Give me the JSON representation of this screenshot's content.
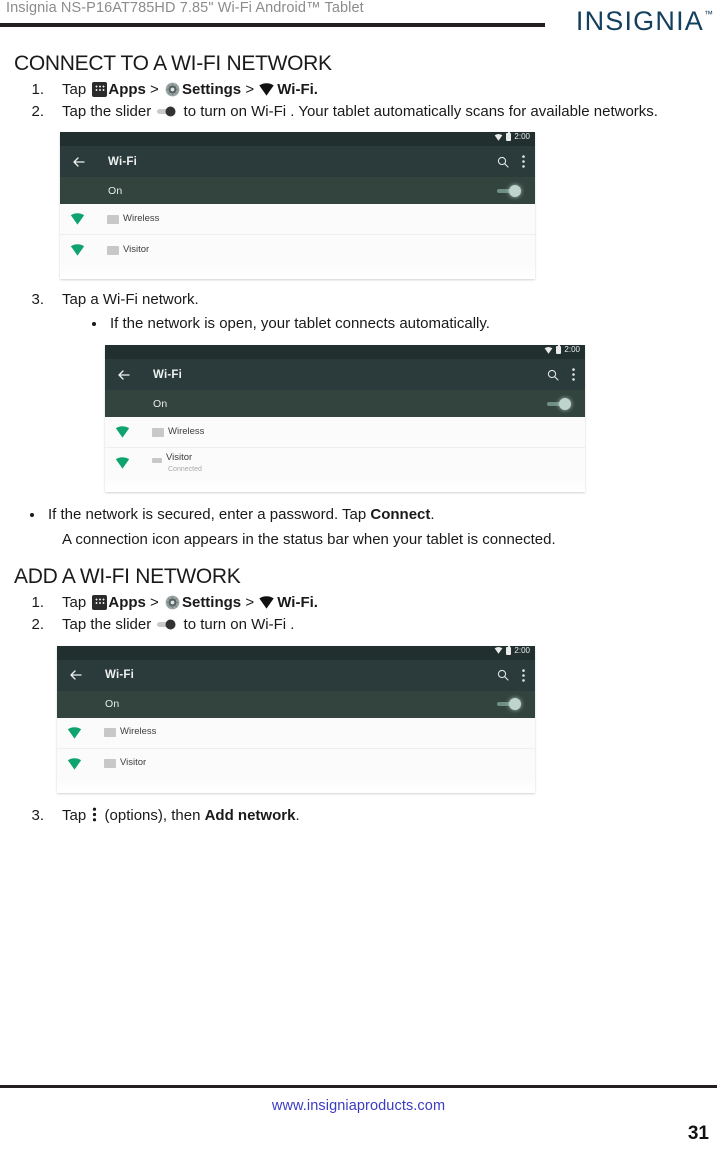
{
  "header": {
    "title": "Insignia  NS-P16AT785HD  7.85\" Wi-Fi Android™ Tablet",
    "brand": "INSIGNIA",
    "brand_tm": "™"
  },
  "sections": [
    {
      "heading": "CONNECT TO A WI-FI NETWORK",
      "steps": [
        {
          "num": "1.",
          "pre": "Tap ",
          "apps_label": "Apps",
          "sep1": " > ",
          "settings_label": "Settings",
          "sep2": " > ",
          "wifi_label": "Wi-Fi."
        },
        {
          "num": "2.",
          "pre": "Tap the slider ",
          "post": " to turn on Wi-Fi . Your tablet automatically scans for available networks."
        },
        {
          "num": "3.",
          "text": "Tap a Wi-Fi network.",
          "bullets": [
            {
              "text": "If the network is open, your tablet connects automatically."
            }
          ]
        }
      ],
      "trailing_bullets": [
        {
          "pre": "If the network is secured, enter a password. Tap ",
          "bold": "Connect",
          "post": "."
        }
      ],
      "note": "A connection icon appears in the status bar when your tablet is connected."
    },
    {
      "heading": "ADD A WI-FI NETWORK",
      "steps": [
        {
          "num": "1.",
          "pre": "Tap ",
          "apps_label": "Apps",
          "sep1": " > ",
          "settings_label": "Settings",
          "sep2": " > ",
          "wifi_label": "Wi-Fi."
        },
        {
          "num": "2.",
          "pre": "Tap the slider ",
          "post": " to turn on Wi-Fi ."
        },
        {
          "num": "3.",
          "pre": "Tap ",
          "mid": " (options), then ",
          "bold": "Add network",
          "post": "."
        }
      ]
    }
  ],
  "screenshots": [
    {
      "status_time": "2:00",
      "app_title": "Wi-Fi",
      "toggle_label": "On",
      "networks": [
        {
          "name": "Wireless",
          "status": ""
        },
        {
          "name": "Visitor",
          "status": ""
        }
      ]
    },
    {
      "status_time": "2:00",
      "app_title": "Wi-Fi",
      "toggle_label": "On",
      "networks": [
        {
          "name": "Wireless",
          "status": ""
        },
        {
          "name": "Visitor",
          "status": "Connected"
        }
      ]
    },
    {
      "status_time": "2:00",
      "app_title": "Wi-Fi",
      "toggle_label": "On",
      "networks": [
        {
          "name": "Wireless",
          "status": ""
        },
        {
          "name": "Visitor",
          "status": ""
        }
      ]
    }
  ],
  "footer": {
    "url": "www.insigniaproducts.com",
    "page_number": "31"
  },
  "colors": {
    "brand_navy": "#14405f",
    "rule_black": "#231f20",
    "footer_link": "#3b3bc4",
    "shot_appbar": "#2b3b3b",
    "shot_statusbar": "#21302f",
    "shot_toggle_row": "#33443f",
    "wifi_green": "#0fa46f"
  }
}
